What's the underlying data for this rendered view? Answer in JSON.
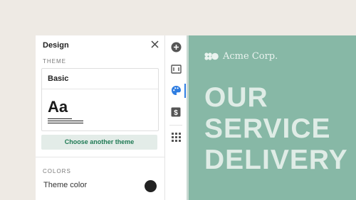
{
  "panel": {
    "title": "Design",
    "theme_section_label": "THEME",
    "theme_card": {
      "name": "Basic",
      "sample": "Aa"
    },
    "choose_theme_label": "Choose another theme",
    "colors_section_label": "COLORS",
    "theme_color_label": "Theme color",
    "theme_color_value": "#222222"
  },
  "rail": {
    "items": [
      {
        "icon": "plus-circle-icon"
      },
      {
        "icon": "frame-icon"
      },
      {
        "icon": "palette-icon",
        "active": true
      },
      {
        "icon": "dollar-icon"
      },
      {
        "icon": "grid-icon"
      }
    ],
    "active_color": "#2f7de1"
  },
  "preview": {
    "background": "#87b8a6",
    "brand_name": "Acme Corp.",
    "headline": [
      "OUR",
      "SERVICE",
      "DELIVERY"
    ]
  }
}
